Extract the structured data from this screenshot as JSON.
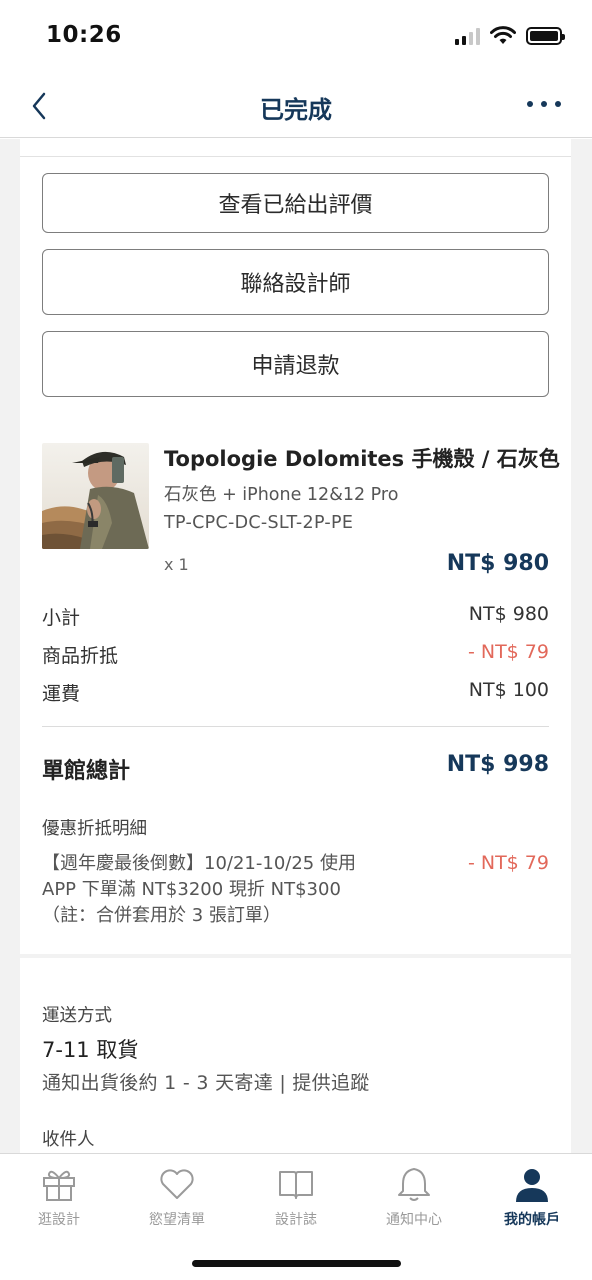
{
  "status_bar": {
    "time": "10:26"
  },
  "nav": {
    "title": "已完成"
  },
  "actions": {
    "view_review": "查看已給出評價",
    "contact_designer": "聯絡設計師",
    "refund": "申請退款"
  },
  "product": {
    "name": "Topologie Dolomites 手機殼 / 石灰色",
    "variant": "石灰色 + iPhone 12&12 Pro",
    "sku": "TP-CPC-DC-SLT-2P-PE",
    "quantity": "x 1",
    "price": "NT$ 980"
  },
  "summary": {
    "subtotal_label": "小計",
    "subtotal_value": "NT$ 980",
    "discount_label": "商品折抵",
    "discount_value": "- NT$ 79",
    "shipping_label": "運費",
    "shipping_value": "NT$ 100",
    "total_label": "單館總計",
    "total_value": "NT$ 998"
  },
  "promo": {
    "title": "優惠折抵明細",
    "line1": "【週年慶最後倒數】10/21-10/25 使用",
    "line2": "APP 下單滿 NT$3200 現折 NT$300",
    "line3": "（註：合併套用於 3 張訂單）",
    "value": "- NT$ 79"
  },
  "shipping": {
    "title": "運送方式",
    "method": "7-11 取貨",
    "note": "通知出貨後約 1 - 3 天寄達 | 提供追蹤",
    "recipient_title": "收件人"
  },
  "tabs": [
    {
      "label": "逛設計",
      "icon": "gift-icon"
    },
    {
      "label": "慾望清單",
      "icon": "heart-icon"
    },
    {
      "label": "設計誌",
      "icon": "book-icon"
    },
    {
      "label": "通知中心",
      "icon": "bell-icon"
    },
    {
      "label": "我的帳戶",
      "icon": "user-icon"
    }
  ],
  "colors": {
    "brand": "#16385a",
    "discount": "#e2685a",
    "inactive_tab": "#9a9a9a"
  }
}
